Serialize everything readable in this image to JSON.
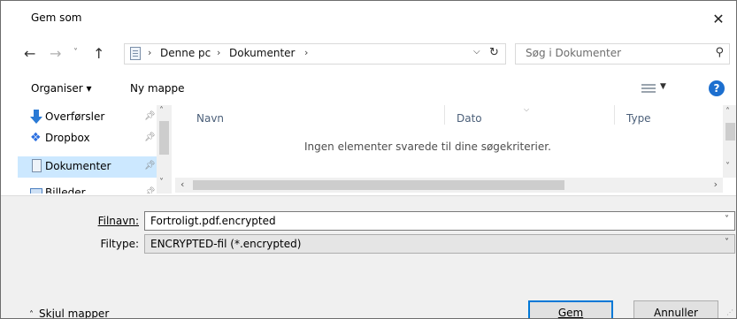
{
  "dialog": {
    "title": "Gem som"
  },
  "address": {
    "crumbs": [
      "Denne pc",
      "Dokumenter"
    ],
    "search_placeholder": "Søg i Dokumenter"
  },
  "toolbar": {
    "organize": "Organiser ▾",
    "new_folder": "Ny mappe"
  },
  "nav": {
    "items": [
      {
        "label": "Overførsler",
        "icon": "downloads-icon"
      },
      {
        "label": "Dropbox",
        "icon": "dropbox-icon"
      },
      {
        "label": "Dokumenter",
        "icon": "documents-icon",
        "selected": true
      },
      {
        "label": "Billeder",
        "icon": "pictures-icon"
      }
    ]
  },
  "list": {
    "columns": [
      "Navn",
      "Dato",
      "Type"
    ],
    "empty_message": "Ingen elementer svarede til dine søgekriterier."
  },
  "form": {
    "filename_label": "Filnavn:",
    "filename_value": "Fortroligt.pdf.encrypted",
    "filetype_label": "Filtype:",
    "filetype_value": "ENCRYPTED-fil (*.encrypted)"
  },
  "footer": {
    "hide_folders": "Skjul mapper",
    "save": "Gem",
    "cancel": "Annuller"
  },
  "colors": {
    "accent": "#0078d7",
    "selection": "#cce8ff",
    "help": "#1c6fcf"
  }
}
